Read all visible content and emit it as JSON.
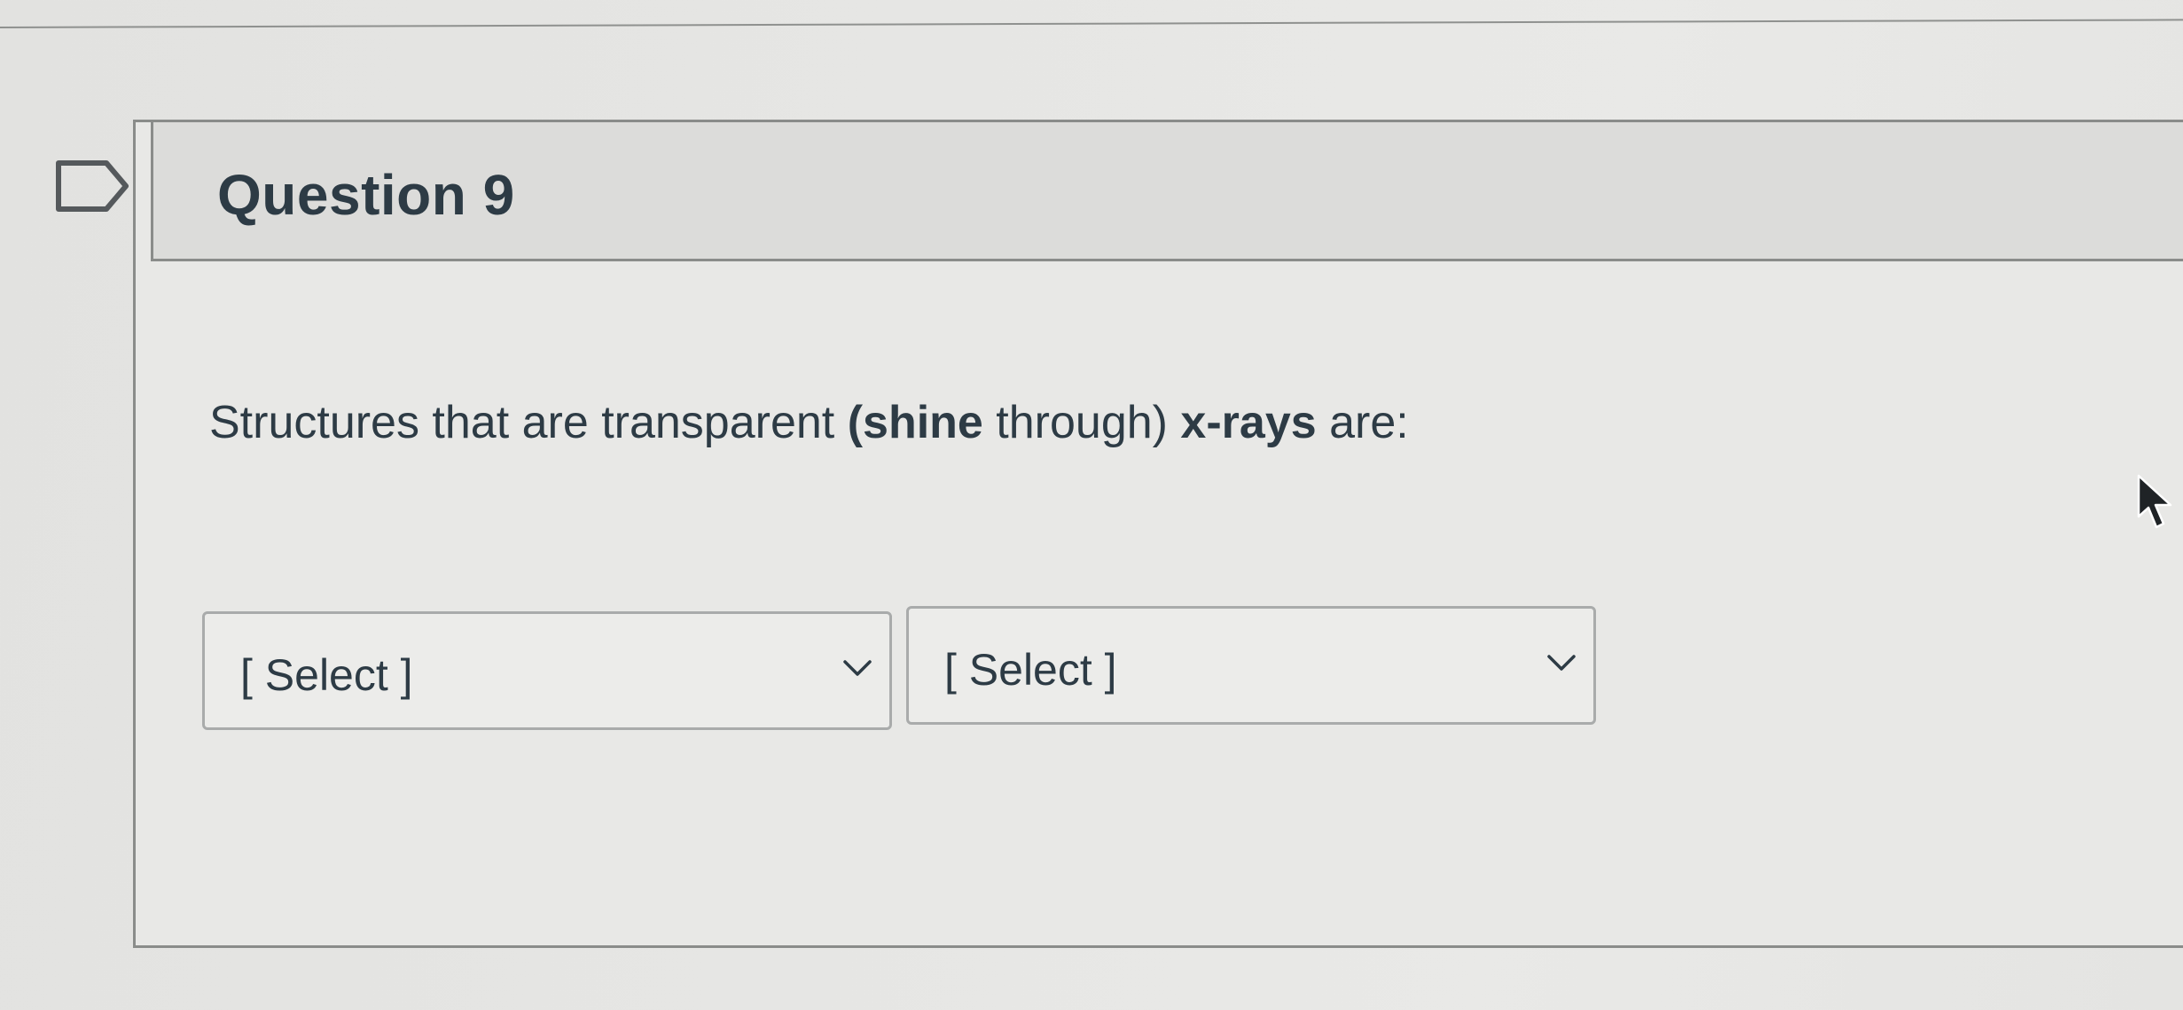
{
  "question": {
    "title": "Question 9",
    "prompt_segments": [
      "Structures that are transparent ",
      "(shine",
      " through) ",
      "x-rays",
      " are:"
    ]
  },
  "selects": [
    {
      "value": "[ Select ]",
      "icon": "chevron-down-icon"
    },
    {
      "value": "[ Select ]",
      "icon": "chevron-down-icon"
    }
  ],
  "icons": {
    "flag": "flag-icon",
    "cursor": "mouse-cursor-icon"
  },
  "colors": {
    "text": "#2d3b45",
    "border": "#8a8c8a",
    "header_bg": "#dcdcda"
  }
}
